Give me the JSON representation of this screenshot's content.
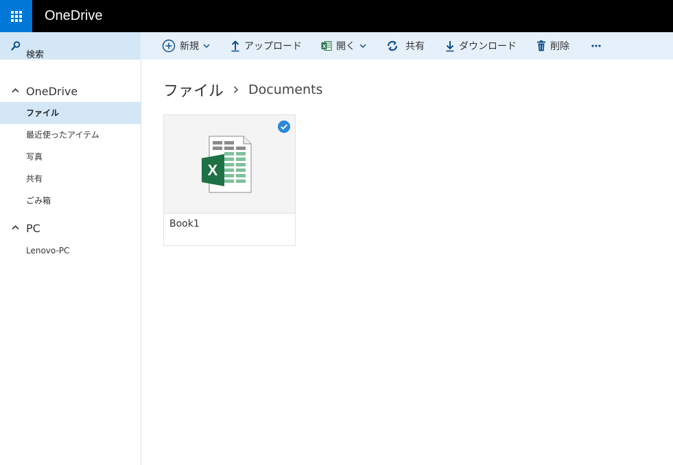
{
  "app": {
    "title": "OneDrive",
    "waffle_icon": "app-launcher-icon",
    "accent": "#0078d7"
  },
  "search": {
    "label": "検索",
    "icon": "search-icon"
  },
  "commands": {
    "new": "新規",
    "upload": "アップロード",
    "open": "開く",
    "share": "共有",
    "download": "ダウンロード",
    "delete": "削除",
    "more": "more-icon"
  },
  "nav": {
    "onedrive_heading": "OneDrive",
    "items": [
      {
        "label": "ファイル",
        "active": true
      },
      {
        "label": "最近使ったアイテム"
      },
      {
        "label": "写真"
      },
      {
        "label": "共有"
      },
      {
        "label": "ごみ箱"
      }
    ],
    "pc_heading": "PC",
    "pc_items": [
      {
        "label": "Lenovo-PC"
      }
    ]
  },
  "breadcrumb": {
    "root": "ファイル",
    "current": "Documents"
  },
  "files": [
    {
      "name": "Book1",
      "type": "excel-workbook",
      "selected": true
    }
  ],
  "colors": {
    "selection": "#d3e7f7",
    "command_bar": "#e6f0fa",
    "excel_green": "#1e7145",
    "check": "#2b88d8"
  }
}
